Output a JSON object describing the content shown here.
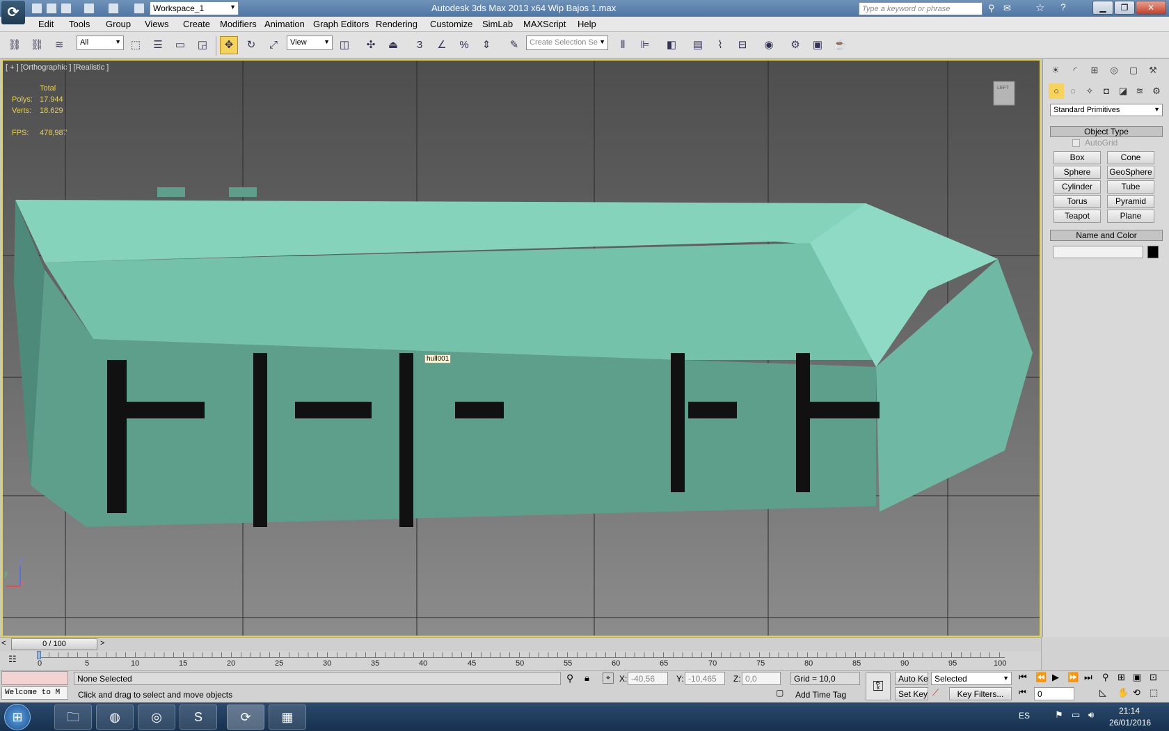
{
  "titlebar": {
    "workspace": "Workspace_1",
    "title": "Autodesk 3ds Max  2013 x64     Wip Bajos 1.max",
    "search_placeholder": "Type a keyword or phrase"
  },
  "menu": [
    "Edit",
    "Tools",
    "Group",
    "Views",
    "Create",
    "Modifiers",
    "Animation",
    "Graph Editors",
    "Rendering",
    "Customize",
    "SimLab",
    "MAXScript",
    "Help"
  ],
  "toolbar": {
    "filter_select": "All",
    "coord_select": "View",
    "selection_set_placeholder": "Create Selection Se",
    "snap_label": "3"
  },
  "viewport": {
    "label": "[ + ] [Orthographic ] [Realistic ]",
    "stats": {
      "total_label": "Total",
      "polys_label": "Polys:",
      "polys": "17.944",
      "verts_label": "Verts:",
      "verts": "18.629",
      "fps_label": "FPS:",
      "fps": "478,987"
    },
    "tooltip": "hull001",
    "viewcube_label": "LEFT",
    "axis_z": "z",
    "axis_x": "x",
    "axis_y": "y",
    "hull_color": "#6fb8a4"
  },
  "command_panel": {
    "category_select": "Standard Primitives",
    "object_type_title": "Object Type",
    "autogrid": "AutoGrid",
    "buttons": [
      "Box",
      "Cone",
      "Sphere",
      "GeoSphere",
      "Cylinder",
      "Tube",
      "Torus",
      "Pyramid",
      "Teapot",
      "Plane"
    ],
    "name_color_title": "Name and Color",
    "color_swatch": "#000000"
  },
  "timeline": {
    "frame": "0 / 100",
    "ticks": [
      "0",
      "5",
      "10",
      "15",
      "20",
      "25",
      "30",
      "35",
      "40",
      "45",
      "50",
      "55",
      "60",
      "65",
      "70",
      "75",
      "80",
      "85",
      "90",
      "95",
      "100"
    ]
  },
  "status": {
    "listener": "Welcome to M",
    "selection": "None Selected",
    "prompt": "Click and drag to select and move objects",
    "x_label": "X:",
    "x": "-40,56",
    "y_label": "Y:",
    "y": "-10,465",
    "z_label": "Z:",
    "z": "0,0",
    "grid": "Grid = 10,0",
    "add_time_tag": "Add Time Tag",
    "auto_key": "Auto Key",
    "key_mode": "Selected",
    "set_key": "Set Key",
    "key_filters": "Key Filters...",
    "current_frame": "0"
  },
  "taskbar": {
    "lang": "ES",
    "time": "21:14",
    "date": "26/01/2016"
  }
}
